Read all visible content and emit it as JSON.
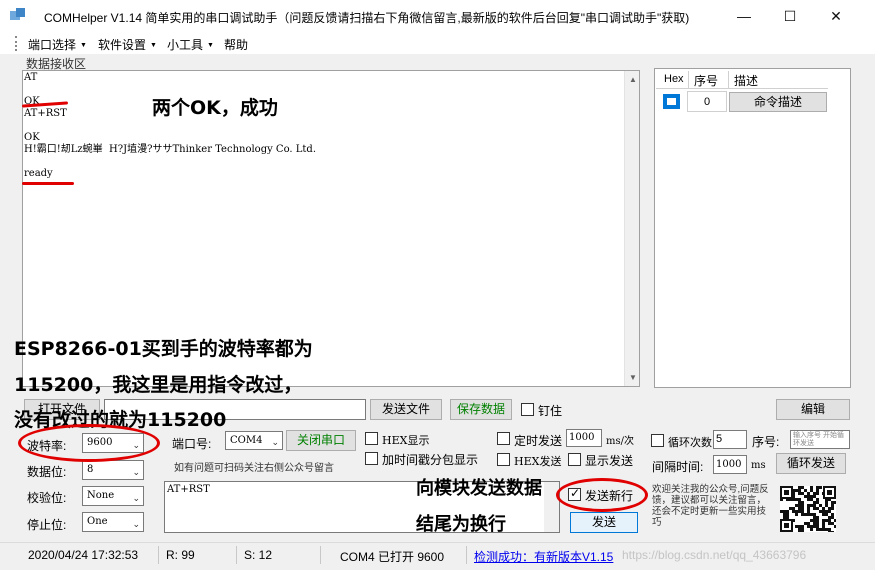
{
  "title": "COMHelper V1.14 简单实用的串口调试助手（问题反馈请扫描右下角微信留言,最新版的软件后台回复\"串口调试助手\"获取)",
  "window_controls": {
    "minimize": "—",
    "maximize": "☐",
    "close": "✕"
  },
  "menu": [
    {
      "label": "端口选择",
      "has_dropdown": true
    },
    {
      "label": "软件设置",
      "has_dropdown": true
    },
    {
      "label": "小工具",
      "has_dropdown": true
    },
    {
      "label": "帮助",
      "has_dropdown": false
    }
  ],
  "receive": {
    "group_label": "数据接收区",
    "lines": [
      "AT",
      "",
      "OK",
      "AT+RST",
      "",
      "OK",
      "H!霸口!刼Lz蜿崋  H?J埴漫?ササThinker Technology Co. Ltd.",
      "",
      "ready"
    ]
  },
  "command_table": {
    "headers": {
      "hex": "Hex",
      "num": "序号",
      "desc": "描述"
    },
    "rows": [
      {
        "checked": true,
        "num": "0",
        "button": "命令描述"
      }
    ]
  },
  "file_row": {
    "open_file": "打开文件",
    "path": "",
    "send_file": "发送文件",
    "save_data": "保存数据",
    "pin_label": "钉住",
    "edit": "编辑"
  },
  "serial": {
    "baud_label": "波特率:",
    "baud_value": "9600",
    "databits_label": "数据位:",
    "databits_value": "8",
    "parity_label": "校验位:",
    "parity_value": "None",
    "stopbits_label": "停止位:",
    "stopbits_value": "One",
    "port_label": "端口号:",
    "port_value": "COM4",
    "close_port": "关闭串口",
    "hint": "如有问题可扫码关注右侧公众号留言"
  },
  "options": {
    "hex_display": "HEX显示",
    "add_timestamp": "加时间戳分包显示",
    "timed_send": "定时发送",
    "timed_value": "1000",
    "timed_unit": "ms/次",
    "hex_send": "HEX发送",
    "show_send": "显示发送",
    "send_newline": "发送新行",
    "send_newline_checked": true,
    "loop_label": "循环次数",
    "loop_value": "5",
    "seq_label": "序号:",
    "seq_placeholder": "输入序号 开始循环发送",
    "interval_label": "间隔时间:",
    "interval_value": "1000",
    "interval_unit": "ms",
    "loop_send": "循环发送"
  },
  "send": {
    "text": "AT+RST",
    "button": "发送"
  },
  "promo": "欢迎关注我的公众号,问题反馈，建议都可以关注留言，还会不定时更新一些实用技巧",
  "status": {
    "datetime": "2020/04/24 17:32:53",
    "received": "R:  99",
    "sent": "S:  12",
    "port_state": "COM4 已打开  9600",
    "update": "检测成功：有新版本V1.15",
    "watermark": "https://blog.csdn.net/qq_43663796"
  },
  "annotations": {
    "two_ok": "两个OK，成功",
    "note1": "ESP8266-01买到手的波特率都为",
    "note2": "115200，我这里是用指令改过，",
    "note3": "没有改过的就为115200",
    "newline1": "向模块发送数据",
    "newline2": "结尾为换行"
  },
  "colors": {
    "annotation_red": "#e00000",
    "accent_blue": "#0078d7",
    "green_text": "#008000",
    "link_blue": "#0000ee"
  }
}
